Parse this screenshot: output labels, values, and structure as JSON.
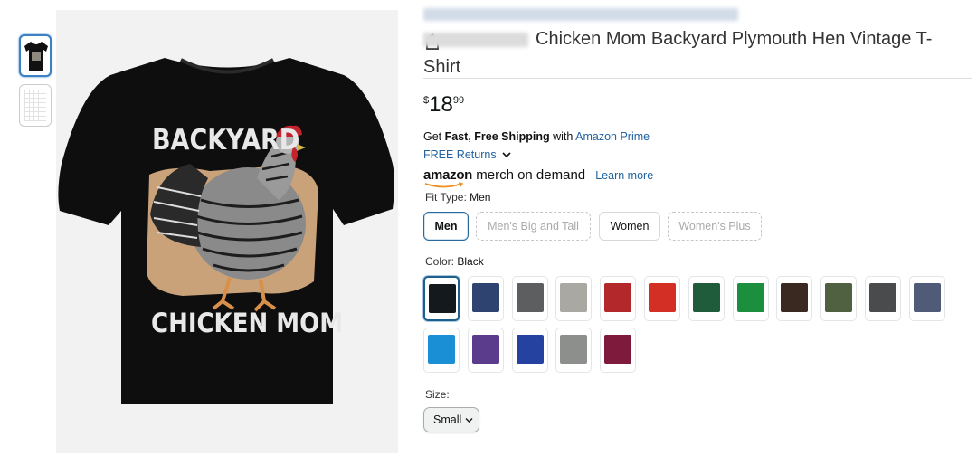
{
  "product": {
    "title_line1": "Chicken Mom Backyard Plymouth Hen Vintage T-",
    "title_line2": "Shirt",
    "shirt_text_top": "BACKYARD",
    "shirt_text_bottom": "CHICKEN MOM"
  },
  "price": {
    "symbol": "$",
    "whole": "18",
    "fraction": "99"
  },
  "shipping": {
    "prefix": "Get ",
    "bold": "Fast, Free Shipping",
    "middle": " with ",
    "prime_link": "Amazon Prime",
    "returns": "FREE Returns"
  },
  "merch": {
    "brand_word": "amazon",
    "brand_rest": " merch on demand",
    "learn_more": "Learn more"
  },
  "fit_type": {
    "label": "Fit Type: ",
    "selected": "Men",
    "options": [
      {
        "label": "Men",
        "state": "selected"
      },
      {
        "label": "Men's Big and Tall",
        "state": "unavailable"
      },
      {
        "label": "Women",
        "state": "available"
      },
      {
        "label": "Women's Plus",
        "state": "unavailable"
      }
    ]
  },
  "color": {
    "label": "Color: ",
    "selected": "Black",
    "swatches": [
      "#14191d",
      "#2e4370",
      "#5d5e5f",
      "#a9a8a3",
      "#b3282a",
      "#d42f25",
      "#1f5c3b",
      "#1c8f3f",
      "#3a2920",
      "#4f6140",
      "#4a4b4d",
      "#4f5b77",
      "#1a8fd6",
      "#5a3b8c",
      "#2542a0",
      "#8c8f8c",
      "#7e1a3c"
    ]
  },
  "size": {
    "label": "Size:",
    "selected": "Small"
  },
  "colors": {
    "accent_link": "#2162a1",
    "selected_border": "#1f5f8b",
    "shirt": "#0e0e0e"
  },
  "icons": {
    "share": "share-icon",
    "chevron": "chevron-down-icon"
  }
}
